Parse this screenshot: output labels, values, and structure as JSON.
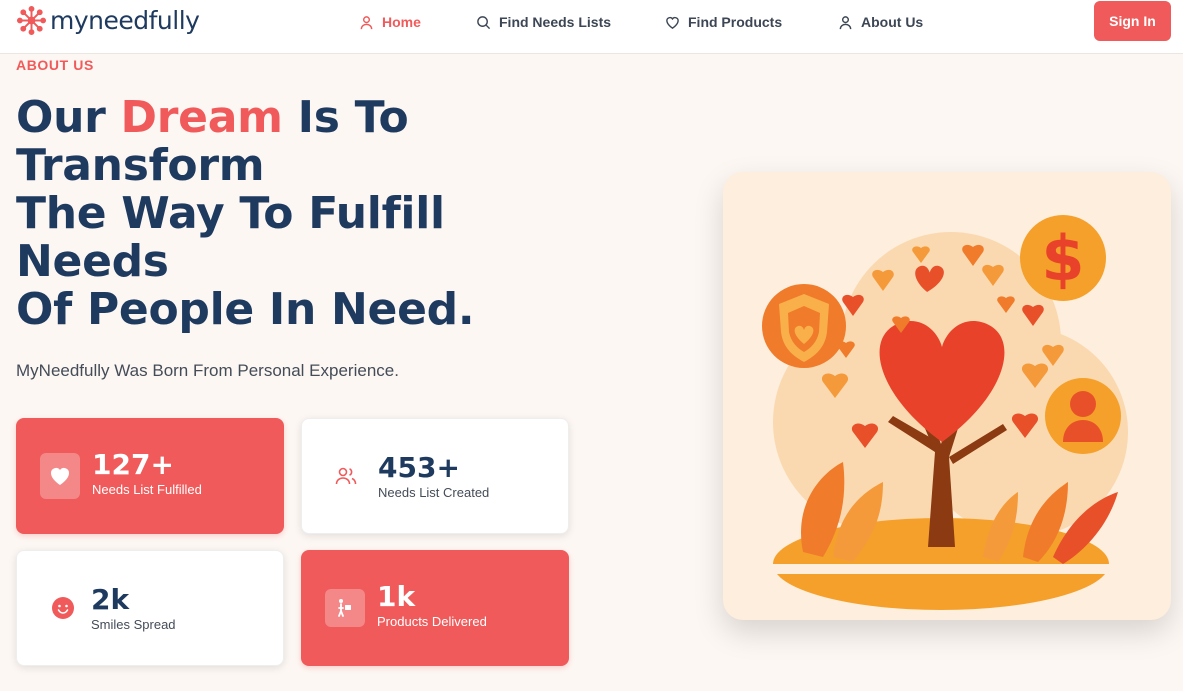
{
  "brand": {
    "name": "myneedfully",
    "accent": "#f05a5a",
    "navy": "#1e3a5f"
  },
  "nav": {
    "items": [
      {
        "label": "Home",
        "icon": "user-icon",
        "active": true
      },
      {
        "label": "Find Needs Lists",
        "icon": "search-icon",
        "active": false
      },
      {
        "label": "Find Products",
        "icon": "heart-icon",
        "active": false
      },
      {
        "label": "About Us",
        "icon": "user-icon",
        "active": false
      }
    ],
    "signin_label": "Sign In"
  },
  "hero": {
    "eyebrow": "ABOUT US",
    "headline_pre": "Our ",
    "headline_accent": "Dream",
    "headline_line1_post": " Is To",
    "headline_line2": "Transform",
    "headline_line3": "The Way To Fulfill",
    "headline_line4": "Needs",
    "headline_line5": "Of People In Need.",
    "subtitle": "MyNeedfully Was Born From Personal Experience."
  },
  "stats": [
    {
      "value": "127+",
      "label": "Needs List Fulfilled",
      "icon": "heart-icon",
      "style": "red"
    },
    {
      "value": "453+",
      "label": "Needs List Created",
      "icon": "users-icon",
      "style": "white"
    },
    {
      "value": "2k",
      "label": "Smiles Spread",
      "icon": "smile-icon",
      "style": "white"
    },
    {
      "value": "1k",
      "label": "Products Delivered",
      "icon": "delivery-icon",
      "style": "red"
    }
  ],
  "illustration": {
    "icon": "heart-tree-illustration"
  }
}
